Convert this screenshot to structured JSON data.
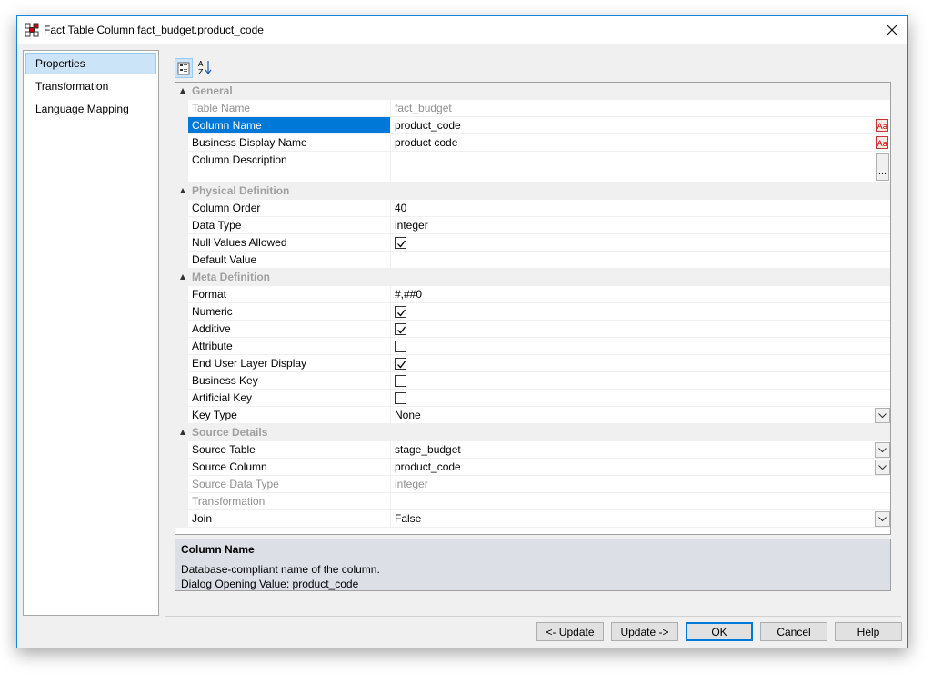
{
  "window": {
    "title": "Fact Table Column fact_budget.product_code"
  },
  "nav": {
    "items": [
      {
        "label": "Properties",
        "selected": true
      },
      {
        "label": "Transformation",
        "selected": false
      },
      {
        "label": "Language Mapping",
        "selected": false
      }
    ]
  },
  "toolbar": {
    "icons": [
      "categorized-icon",
      "sort-alphabetical-icon"
    ]
  },
  "grid": {
    "general": {
      "label": "General",
      "table_name": {
        "name": "Table Name",
        "value": "fact_budget"
      },
      "column_name": {
        "name": "Column Name",
        "value": "product_code"
      },
      "business_display_name": {
        "name": "Business Display Name",
        "value": "product code"
      },
      "column_description": {
        "name": "Column Description",
        "value": ""
      },
      "ellipsis": "..."
    },
    "physical": {
      "label": "Physical Definition",
      "column_order": {
        "name": "Column Order",
        "value": "40"
      },
      "data_type": {
        "name": "Data Type",
        "value": "integer"
      },
      "null_values_allowed": {
        "name": "Null Values Allowed",
        "checked": true
      },
      "default_value": {
        "name": "Default Value",
        "value": ""
      }
    },
    "meta": {
      "label": "Meta Definition",
      "format": {
        "name": "Format",
        "value": "#,##0"
      },
      "numeric": {
        "name": "Numeric",
        "checked": true
      },
      "additive": {
        "name": "Additive",
        "checked": true
      },
      "attribute": {
        "name": "Attribute",
        "checked": false
      },
      "end_user_layer_display": {
        "name": "End User Layer Display",
        "checked": true
      },
      "business_key": {
        "name": "Business Key",
        "checked": false
      },
      "artificial_key": {
        "name": "Artificial Key",
        "checked": false
      },
      "key_type": {
        "name": "Key Type",
        "value": "None"
      }
    },
    "source": {
      "label": "Source Details",
      "source_table": {
        "name": "Source Table",
        "value": "stage_budget"
      },
      "source_column": {
        "name": "Source Column",
        "value": "product_code"
      },
      "source_data_type": {
        "name": "Source Data Type",
        "value": "integer"
      },
      "transformation": {
        "name": "Transformation",
        "value": ""
      },
      "join": {
        "name": "Join",
        "value": "False"
      }
    }
  },
  "help": {
    "title": "Column Name",
    "line1": "Database-compliant name of the column.",
    "line2": "Dialog Opening Value: product_code"
  },
  "buttons": {
    "prev_update": "<- Update",
    "next_update": "Update ->",
    "ok": "OK",
    "cancel": "Cancel",
    "help": "Help"
  },
  "colors": {
    "selection": "#0078d7",
    "window_border": "#1883d7",
    "category_text": "#a0a0a0"
  }
}
